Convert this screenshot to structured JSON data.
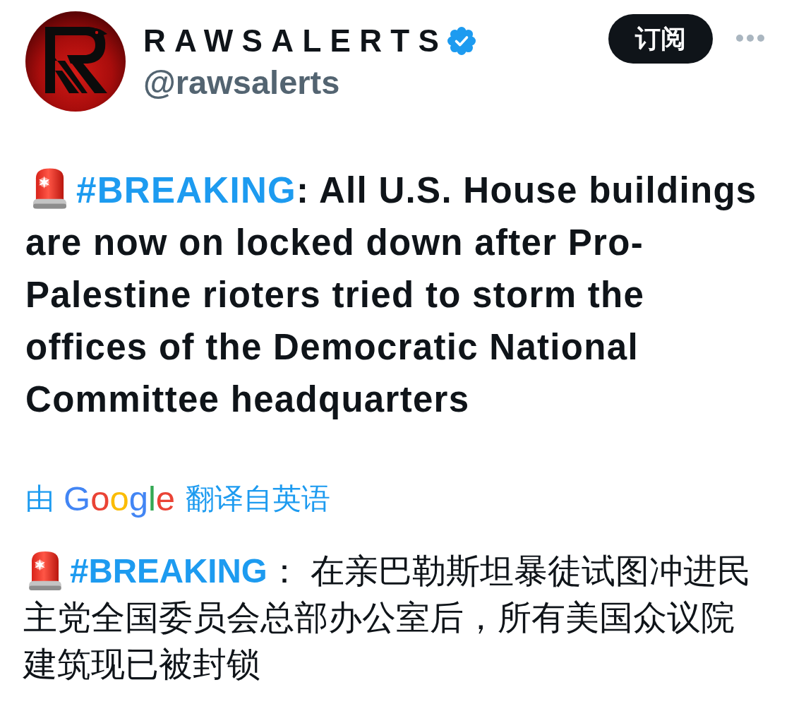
{
  "profile": {
    "name": "RAWSALERTS",
    "verified": true,
    "handle": "@rawsalerts"
  },
  "subscribe_button": {
    "label": "订阅"
  },
  "post": {
    "hashtag": "#BREAKING",
    "text": ": All U.S. House buildings are now on locked down after Pro-Palestine rioters tried to storm the offices of the Democratic National Committee headquarters"
  },
  "translation_note": {
    "prefix": "由",
    "provider": "Google",
    "suffix": "翻译自英语"
  },
  "translated_post": {
    "hashtag": "#BREAKING",
    "text": "： 在亲巴勒斯坦暴徒试图冲进民主党全国委员会总部办公室后，所有美国众议院建筑现已被封锁"
  }
}
